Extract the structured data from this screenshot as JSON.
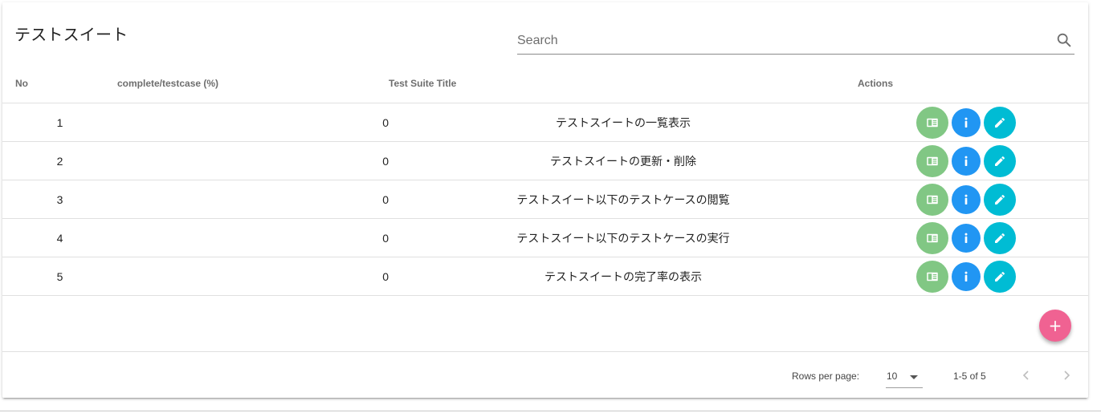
{
  "page": {
    "title": "テストスイート"
  },
  "search": {
    "placeholder": "Search",
    "value": ""
  },
  "table": {
    "headers": {
      "no": "No",
      "complete": "complete/testcase (%)",
      "title": "Test Suite Title",
      "actions": "Actions"
    },
    "rows": [
      {
        "no": "1",
        "complete": "0",
        "title": "テストスイートの一覧表示"
      },
      {
        "no": "2",
        "complete": "0",
        "title": "テストスイートの更新・削除"
      },
      {
        "no": "3",
        "complete": "0",
        "title": "テストスイート以下のテストケースの閲覧"
      },
      {
        "no": "4",
        "complete": "0",
        "title": "テストスイート以下のテストケースの実行"
      },
      {
        "no": "5",
        "complete": "0",
        "title": "テストスイートの完了率の表示"
      }
    ],
    "row_actions": [
      {
        "name": "view-button",
        "icon": "view-list-icon",
        "color": "#81c784"
      },
      {
        "name": "info-button",
        "icon": "info-icon",
        "color": "#2196f3"
      },
      {
        "name": "edit-button",
        "icon": "pencil-icon",
        "color": "#00bcd4"
      }
    ]
  },
  "fab": {
    "label": "+",
    "icon": "plus-icon",
    "color": "#f06292"
  },
  "pagination": {
    "rows_per_page_label": "Rows per page:",
    "rows_per_page": "10",
    "range": "1-5 of 5",
    "prev_icon": "chevron-left-icon",
    "next_icon": "chevron-right-icon"
  }
}
